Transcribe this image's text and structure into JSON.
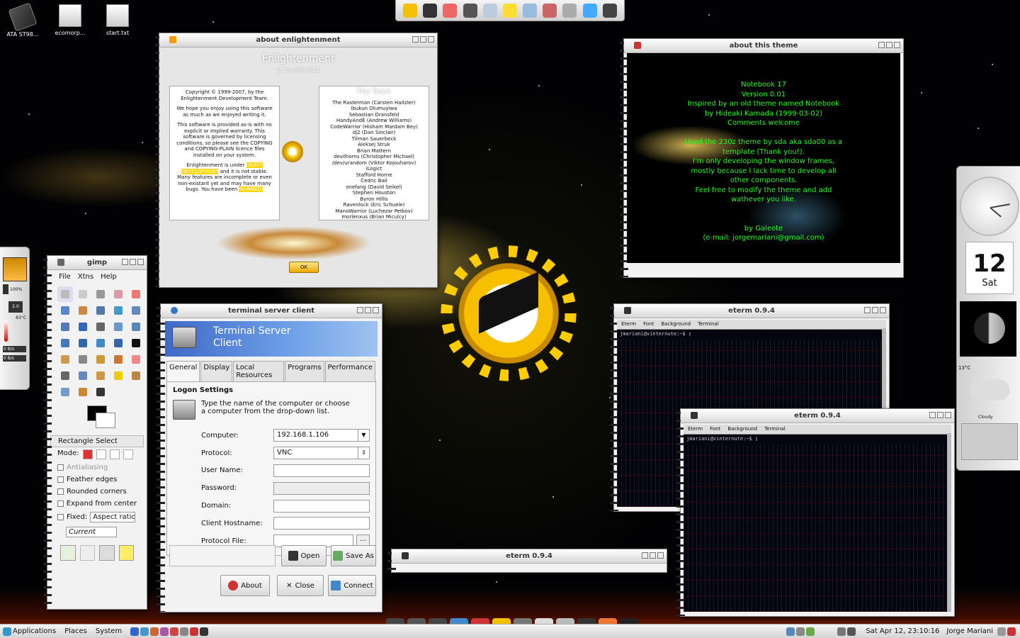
{
  "desktop": {
    "icons": [
      {
        "label": "ATA ST98...",
        "icon": "drive-icon"
      },
      {
        "label": "ecomorp...",
        "icon": "text-file-icon"
      },
      {
        "label": "start.txt",
        "icon": "text-file-icon"
      }
    ]
  },
  "about_e": {
    "title": "about enlightenment",
    "name": "Enlightenment",
    "version": "0.16.999.042",
    "left_text": [
      "Copyright © 1999-2007, by the Enlightenment Development Team.",
      "We hope you enjoy using this software as much as we enjoyed writing it.",
      "This software is provided as-is with no explicit or implied warranty. This software is governed by licensing conditions, so please see the COPYING and COPYING-PLAIN licence files installed on your system."
    ],
    "dev_p1": "Enlightenment is under ",
    "dev_hl1": "HEAVY DEVELOPMENT",
    "dev_p2": " and it is not stable. Many features are incomplete or even non-existant yet and may have many bugs. You have been ",
    "dev_hl2": "WARNED!",
    "team_title": "The Team",
    "team": [
      "The Rasterman (Carsten Haitzler)",
      "Ibukun Olumuyiwa",
      "Sebastian Dransfeld",
      "HandyAndE (Andrew Williams)",
      "CodeWarrior (Hisham Mardam Bey)",
      "dj2 (Dan Sinclair)",
      "Tilman Sauerbeck",
      "Aleksej Struk",
      "Brian Mattern",
      "devilhorns (Christopher Michael)",
      "/dev/urandom (Viktor Kojouharov)",
      "iLogict",
      "Stafford Horne",
      "Cedric Bail",
      "onefang (David Seikel)",
      "Stephen Houston",
      "Byron Hillis",
      "Ravenlock (Eric Schuele)",
      "ManoWarrior (Luchezar Petkov)",
      "morlenxus (Brian Miculcy)"
    ],
    "ok_label": "OK"
  },
  "about_theme": {
    "title": "about this theme",
    "lines": [
      "Notebook 17",
      "Version 0.01",
      "Inspired by an old theme named Notebook",
      "by Hideaki Kamada (1999-03-02)",
      "Comments welcome",
      "",
      "Used the 230z theme by sda aka sda00 as a",
      "template (Thank you!).",
      "I'm only developing the window frames,",
      "mostly because I lack time to develop all",
      "other components.",
      "Feel free to modify the theme and add",
      "wathever you like.",
      "",
      "",
      "by Galeote",
      "(e-mail: jorgemariani@gmail.com)"
    ]
  },
  "gimp": {
    "title": "gimp",
    "menu": [
      "File",
      "Xtns",
      "Help"
    ],
    "tool_options_title": "Rectangle Select",
    "mode_label": "Mode:",
    "options": [
      "Antialiasing",
      "Feather edges",
      "Rounded corners",
      "Expand from center"
    ],
    "fixed_label": "Fixed:",
    "fixed_value": "Aspect ratio",
    "current_value": "Current"
  },
  "tsclient": {
    "title": "terminal server client",
    "banner_line1": "Terminal Server",
    "banner_line2": "Client",
    "tabs": [
      "General",
      "Display",
      "Local Resources",
      "Programs",
      "Performance"
    ],
    "section": "Logon Settings",
    "hint": "Type the name of the computer or choose a computer from the drop-down list.",
    "fields": [
      {
        "label": "Computer:",
        "value": "192.168.1.106",
        "kind": "combo"
      },
      {
        "label": "Protocol:",
        "value": "VNC",
        "kind": "spin"
      },
      {
        "label": "User Name:",
        "value": "",
        "kind": "text"
      },
      {
        "label": "Password:",
        "value": "",
        "kind": "disabled"
      },
      {
        "label": "Domain:",
        "value": "",
        "kind": "text"
      },
      {
        "label": "Client Hostname:",
        "value": "",
        "kind": "text"
      },
      {
        "label": "Protocol File:",
        "value": "",
        "kind": "file"
      }
    ],
    "browse_label": "...",
    "open_label": "Open",
    "save_as_label": "Save As",
    "about_label": "About",
    "close_label": "Close",
    "connect_label": "Connect"
  },
  "eterm1": {
    "title": "eterm 0.9.4",
    "menu": [
      "Eterm",
      "Font",
      "Background",
      "Terminal"
    ],
    "prompt": "jmariani@vinternute:~$"
  },
  "eterm2": {
    "title": "eterm 0.9.4",
    "menu": [
      "Eterm",
      "Font",
      "Background",
      "Terminal"
    ],
    "prompt": "jmariani@vinternute:~$"
  },
  "eterm3": {
    "title": "eterm 0.9.4"
  },
  "right_dock": {
    "day": "12",
    "weekday": "Sat",
    "temp": "13°C",
    "weather": "Cloudy"
  },
  "left_panel": {
    "cpu": "100%",
    "temp": "83°C",
    "net_down": "0 B/s",
    "net_up": "0 B/s",
    "freq": "2.0"
  },
  "panel": {
    "applications": "Applications",
    "places": "Places",
    "system": "System",
    "datetime": "Sat Apr 12, 23:10:16",
    "user": "Jorge Mariani"
  },
  "colors": {
    "accent_gold": "#f5c000",
    "theme_text": "#1cff1c",
    "banner_blue": "#3d6ac8"
  }
}
